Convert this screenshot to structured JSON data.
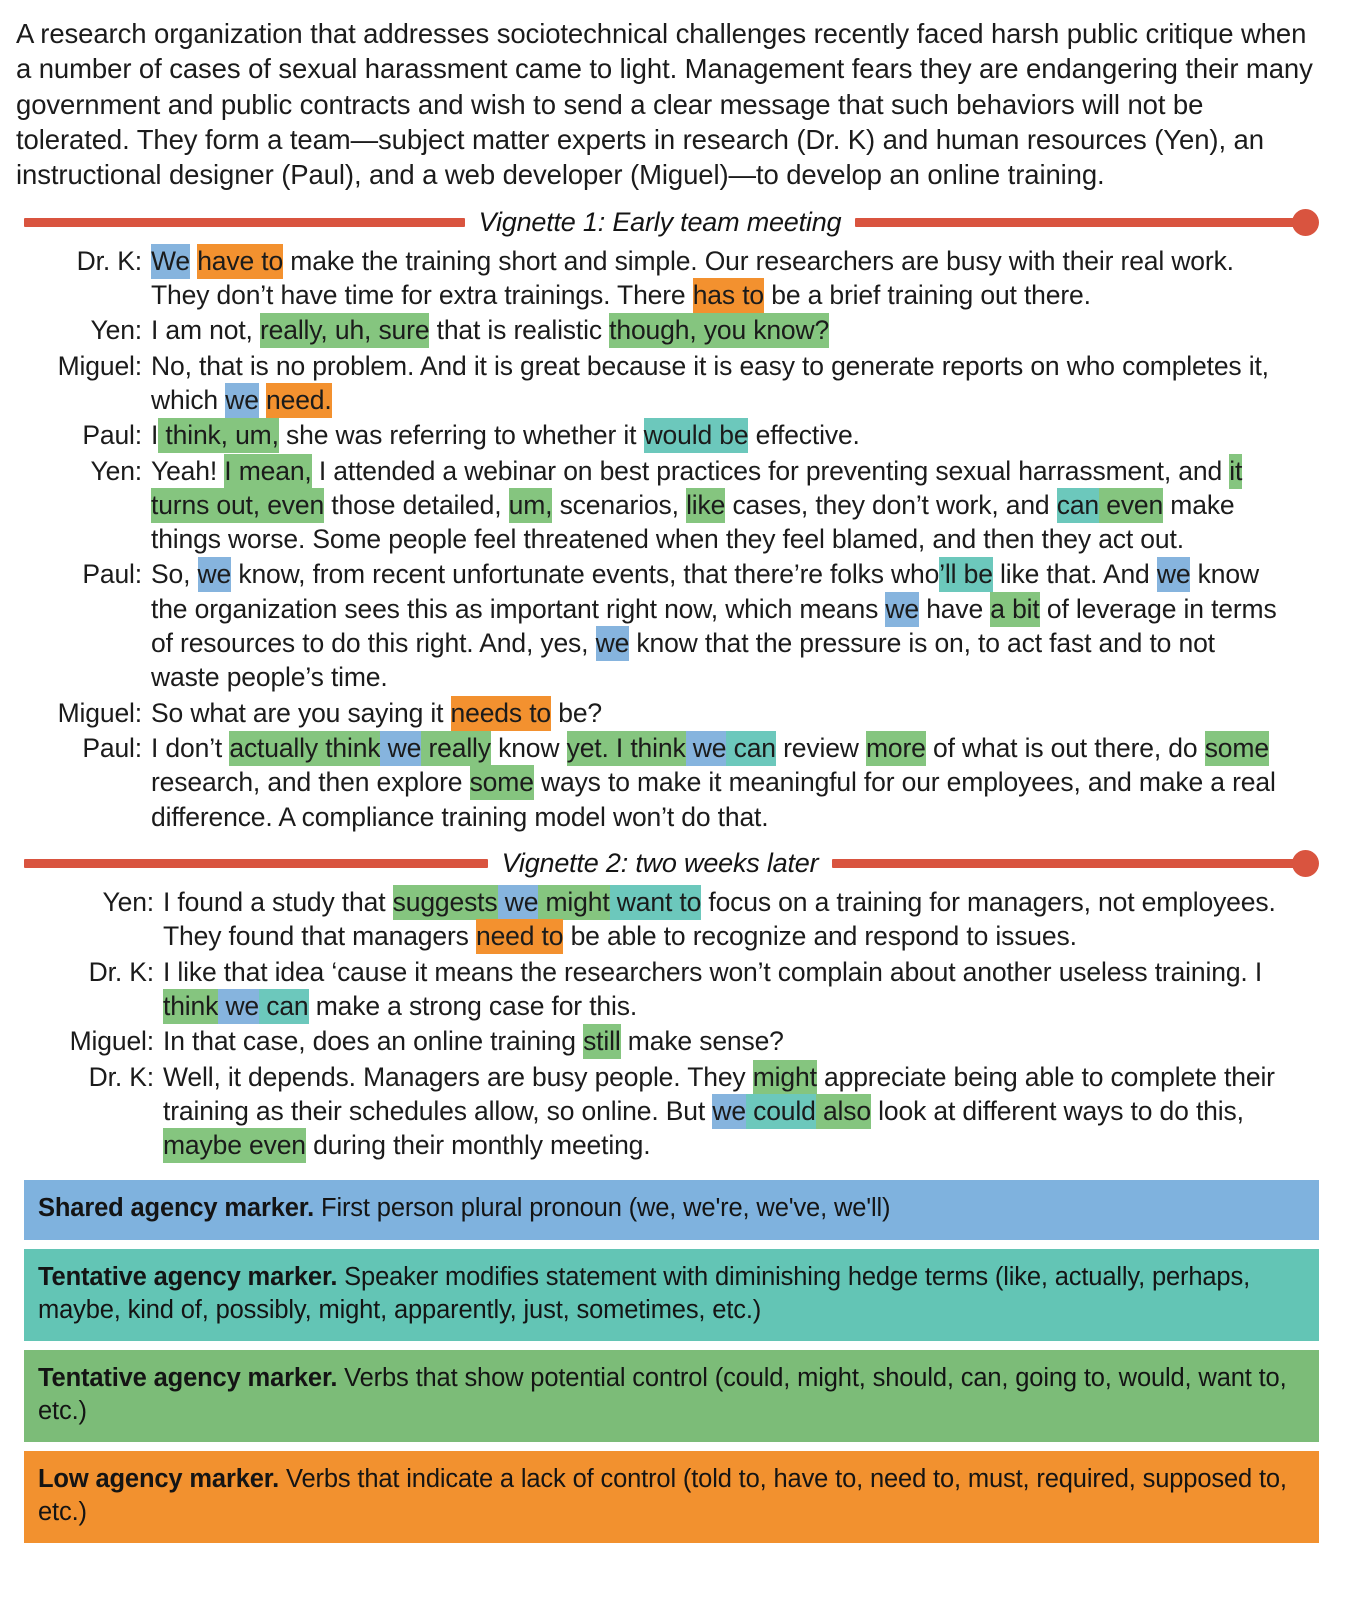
{
  "colors": {
    "shared_blue": "#86b4de",
    "tentative_teal": "#6cc8bc",
    "tentative_green": "#85c57f",
    "low_orange": "#f3912f",
    "divider_red": "#d9543f"
  },
  "intro": {
    "paragraph": "A research organization that addresses sociotechnical challenges recently faced harsh public critique when a number of cases of sexual harassment came to light. Management fears they are endangering their many government and public contracts and wish to send a clear message that such behaviors will not be tolerated. They form a team—subject matter experts in research (Dr. K) and human resources (Yen), an instructional designer (Paul), and a web developer (Miguel)—to develop an online training."
  },
  "vignette1": {
    "title": "Vignette 1: Early team meeting",
    "turns": [
      {
        "speaker": "Dr. K:",
        "parts": [
          {
            "t": "We",
            "h": "blue"
          },
          {
            "t": " ",
            "h": null
          },
          {
            "t": "have to",
            "h": "orange"
          },
          {
            "t": " make the training short and simple. Our researchers are busy with their real work. They don’t have time for extra trainings. There ",
            "h": null
          },
          {
            "t": "has to",
            "h": "orange"
          },
          {
            "t": " be a brief training out there.",
            "h": null
          }
        ]
      },
      {
        "speaker": "Yen:",
        "parts": [
          {
            "t": "I am not, ",
            "h": null
          },
          {
            "t": "really, uh, sure",
            "h": "green"
          },
          {
            "t": " that is realistic ",
            "h": null
          },
          {
            "t": "though, you know?",
            "h": "green"
          }
        ]
      },
      {
        "speaker": "Miguel:",
        "parts": [
          {
            "t": "No, that is no problem. And it is great because it is easy to generate reports on who completes it, which ",
            "h": null
          },
          {
            "t": "we",
            "h": "blue"
          },
          {
            "t": " ",
            "h": null
          },
          {
            "t": "need.",
            "h": "orange"
          }
        ]
      },
      {
        "speaker": "Paul:",
        "parts": [
          {
            "t": "I",
            "h": null
          },
          {
            "t": " think, um,",
            "h": "green"
          },
          {
            "t": " she was referring to whether it ",
            "h": null
          },
          {
            "t": "would be",
            "h": "teal"
          },
          {
            "t": " effective.",
            "h": null
          }
        ]
      },
      {
        "speaker": "Yen:",
        "parts": [
          {
            "t": "Yeah! ",
            "h": null
          },
          {
            "t": "I mean,",
            "h": "green"
          },
          {
            "t": " I attended a webinar on best practices for preventing sexual harrassment, and ",
            "h": null
          },
          {
            "t": "it turns out, even",
            "h": "green"
          },
          {
            "t": " those detailed, ",
            "h": null
          },
          {
            "t": "um,",
            "h": "green"
          },
          {
            "t": " scenarios, ",
            "h": null
          },
          {
            "t": "like",
            "h": "green"
          },
          {
            "t": " cases, they don’t work, and ",
            "h": null
          },
          {
            "t": "can",
            "h": "teal"
          },
          {
            "t": " even",
            "h": "green"
          },
          {
            "t": " make things worse. Some people feel threatened when they feel blamed, and then they act out.",
            "h": null
          }
        ]
      },
      {
        "speaker": "Paul:",
        "parts": [
          {
            "t": "So, ",
            "h": null
          },
          {
            "t": "we",
            "h": "blue"
          },
          {
            "t": " know, from recent unfortunate events, that there’re folks who",
            "h": null
          },
          {
            "t": "’ll be",
            "h": "teal"
          },
          {
            "t": " like that. And ",
            "h": null
          },
          {
            "t": "we",
            "h": "blue"
          },
          {
            "t": " know the organization sees this as important right now, which means ",
            "h": null
          },
          {
            "t": "we",
            "h": "blue"
          },
          {
            "t": " have ",
            "h": null
          },
          {
            "t": "a bit",
            "h": "green"
          },
          {
            "t": " of leverage in terms of resources to do this right. And, yes, ",
            "h": null
          },
          {
            "t": "we",
            "h": "blue"
          },
          {
            "t": " know that the pressure is on, to act fast and to not waste people’s time.",
            "h": null
          }
        ]
      },
      {
        "speaker": "Miguel:",
        "parts": [
          {
            "t": "So what are you saying it ",
            "h": null
          },
          {
            "t": "needs to",
            "h": "orange"
          },
          {
            "t": " be?",
            "h": null
          }
        ]
      },
      {
        "speaker": "Paul:",
        "parts": [
          {
            "t": "I don’t ",
            "h": null
          },
          {
            "t": "actually think",
            "h": "green"
          },
          {
            "t": " we",
            "h": "blue"
          },
          {
            "t": " really",
            "h": "green"
          },
          {
            "t": " know ",
            "h": null
          },
          {
            "t": "yet. I think",
            "h": "green"
          },
          {
            "t": " we",
            "h": "blue"
          },
          {
            "t": " can",
            "h": "teal"
          },
          {
            "t": " review ",
            "h": null
          },
          {
            "t": "more",
            "h": "green"
          },
          {
            "t": " of what is out there, do ",
            "h": null
          },
          {
            "t": "some",
            "h": "green"
          },
          {
            "t": " research, and then explore ",
            "h": null
          },
          {
            "t": "some",
            "h": "green"
          },
          {
            "t": " ways to make it meaningful for our employees, and make a real difference. A compliance training model won’t do that.",
            "h": null
          }
        ]
      }
    ]
  },
  "vignette2": {
    "title": "Vignette 2: two weeks later",
    "turns": [
      {
        "speaker": "Yen:",
        "parts": [
          {
            "t": "I found a study that ",
            "h": null
          },
          {
            "t": "suggests",
            "h": "green"
          },
          {
            "t": " we",
            "h": "blue"
          },
          {
            "t": " might",
            "h": "green"
          },
          {
            "t": " want to",
            "h": "teal"
          },
          {
            "t": " focus on a training for managers, not employees. They found that managers ",
            "h": null
          },
          {
            "t": "need to",
            "h": "orange"
          },
          {
            "t": " be able to recognize and respond to issues.",
            "h": null
          }
        ]
      },
      {
        "speaker": "Dr. K:",
        "parts": [
          {
            "t": "I like that idea ‘cause it means the researchers won’t complain about another useless training. I",
            "h": null
          },
          {
            "t": " think",
            "h": "green"
          },
          {
            "t": " we",
            "h": "blue"
          },
          {
            "t": " can",
            "h": "teal"
          },
          {
            "t": " make a strong case for this.",
            "h": null
          }
        ]
      },
      {
        "speaker": "Miguel:",
        "parts": [
          {
            "t": "In that case, does an online training ",
            "h": null
          },
          {
            "t": "still",
            "h": "green"
          },
          {
            "t": " make sense?",
            "h": null
          }
        ]
      },
      {
        "speaker": "Dr. K:",
        "parts": [
          {
            "t": "Well, it depends. Managers are busy people. They ",
            "h": null
          },
          {
            "t": "might",
            "h": "green"
          },
          {
            "t": " appreciate being able to complete their training as their schedules allow, so online. But ",
            "h": null
          },
          {
            "t": "we",
            "h": "blue"
          },
          {
            "t": " could",
            "h": "teal"
          },
          {
            "t": " also",
            "h": "green"
          },
          {
            "t": " look at different ways to do this, ",
            "h": null
          },
          {
            "t": "maybe even",
            "h": "green"
          },
          {
            "t": " during their monthly meeting.",
            "h": null
          }
        ]
      }
    ]
  },
  "legend": [
    {
      "color": "blue",
      "term": "Shared agency marker.",
      "definition": " First person plural pronoun (we, we're, we've, we'll)"
    },
    {
      "color": "teal",
      "term": "Tentative agency marker.",
      "definition": " Speaker modifies statement with diminishing hedge terms (like, actually, perhaps, maybe, kind of, possibly, might, apparently, just, sometimes, etc.)"
    },
    {
      "color": "green",
      "term": "Tentative agency marker.",
      "definition": " Verbs that show potential control (could, might, should, can, going to, would, want to, etc.)"
    },
    {
      "color": "orange",
      "term": "Low agency marker.",
      "definition": " Verbs that indicate a lack of control (told to, have to, need to, must, required, supposed to, etc.)"
    }
  ]
}
